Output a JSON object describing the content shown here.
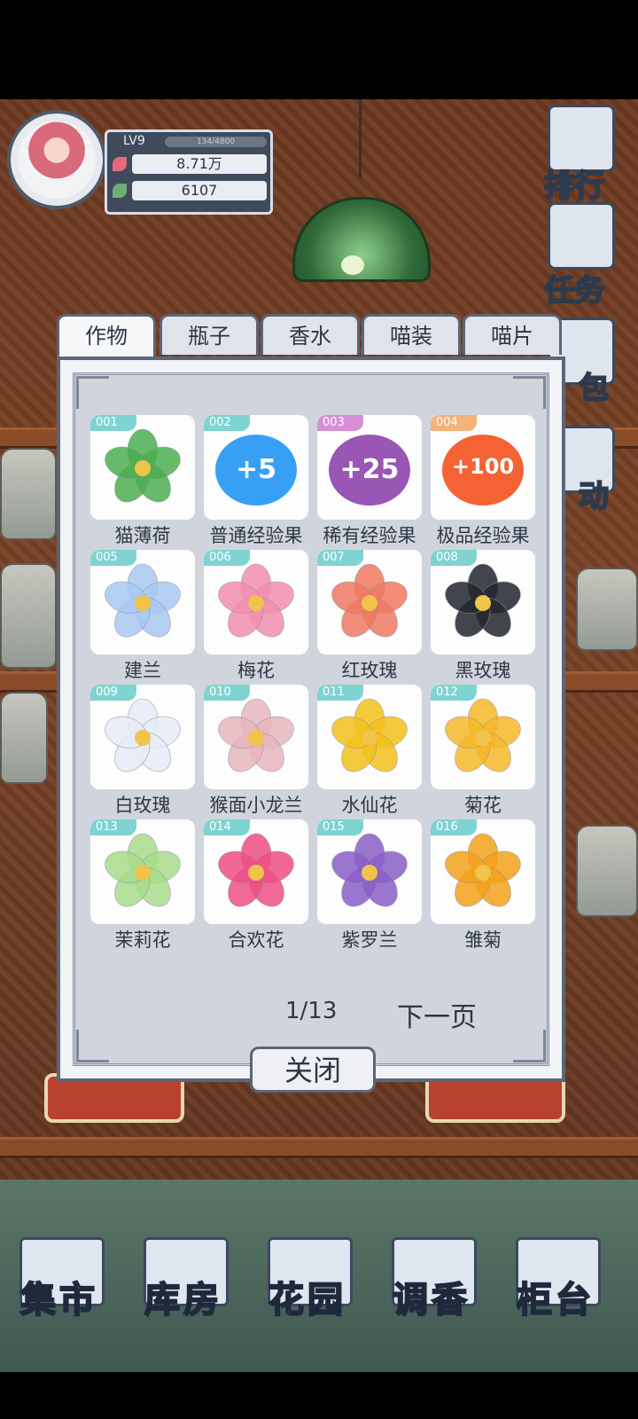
{
  "player": {
    "level": "LV9",
    "exp": "134/4800",
    "coins": "8.71万",
    "gems": "6107"
  },
  "side_menu": [
    {
      "label": "排行",
      "icon": "ranking-icon"
    },
    {
      "label": "任务",
      "icon": "task-clipboard-icon"
    },
    {
      "label": "包",
      "icon": "bag-icon"
    },
    {
      "label": "动",
      "icon": "activity-icon"
    }
  ],
  "tabs": [
    {
      "label": "作物",
      "active": true
    },
    {
      "label": "瓶子",
      "active": false
    },
    {
      "label": "香水",
      "active": false
    },
    {
      "label": "喵装",
      "active": false
    },
    {
      "label": "喵片",
      "active": false
    }
  ],
  "items": [
    {
      "id": "001",
      "name": "猫薄荷",
      "icon": "catnip-icon",
      "color": "#4caf50",
      "badge": "#7fd3d0"
    },
    {
      "id": "002",
      "name": "普通经验果",
      "icon": "exp-fruit-common-icon",
      "color": "#2196f3",
      "badge": "#7fd3d0",
      "value": "+5"
    },
    {
      "id": "003",
      "name": "稀有经验果",
      "icon": "exp-fruit-rare-icon",
      "color": "#8e44ad",
      "badge": "#d58fd6",
      "value": "+25"
    },
    {
      "id": "004",
      "name": "极品经验果",
      "icon": "exp-fruit-epic-icon",
      "color": "#f4511e",
      "badge": "#f2b27a",
      "value": "+100"
    },
    {
      "id": "005",
      "name": "建兰",
      "icon": "orchid-icon",
      "color": "#a9c9f2",
      "badge": "#7fd3d0"
    },
    {
      "id": "006",
      "name": "梅花",
      "icon": "plum-blossom-icon",
      "color": "#f28fb1",
      "badge": "#7fd3d0"
    },
    {
      "id": "007",
      "name": "红玫瑰",
      "icon": "red-rose-icon",
      "color": "#ef7a62",
      "badge": "#7fd3d0"
    },
    {
      "id": "008",
      "name": "黑玫瑰",
      "icon": "black-rose-icon",
      "color": "#23262d",
      "badge": "#7fd3d0"
    },
    {
      "id": "009",
      "name": "白玫瑰",
      "icon": "white-rose-icon",
      "color": "#e8ecf7",
      "badge": "#7fd3d0"
    },
    {
      "id": "010",
      "name": "猴面小龙兰",
      "icon": "monkey-orchid-icon",
      "color": "#e7b7be",
      "badge": "#7fd3d0"
    },
    {
      "id": "011",
      "name": "水仙花",
      "icon": "daffodil-icon",
      "color": "#f3c21b",
      "badge": "#7fd3d0"
    },
    {
      "id": "012",
      "name": "菊花",
      "icon": "chrysanthemum-icon",
      "color": "#f6b829",
      "badge": "#7fd3d0"
    },
    {
      "id": "013",
      "name": "茉莉花",
      "icon": "jasmine-icon",
      "color": "#a8dc8b",
      "badge": "#7fd3d0"
    },
    {
      "id": "014",
      "name": "合欢花",
      "icon": "silk-tree-flower-icon",
      "color": "#ef4f86",
      "badge": "#7fd3d0"
    },
    {
      "id": "015",
      "name": "紫罗兰",
      "icon": "violet-icon",
      "color": "#8a5fc9",
      "badge": "#7fd3d0"
    },
    {
      "id": "016",
      "name": "雏菊",
      "icon": "daisy-icon",
      "color": "#f4a21a",
      "badge": "#7fd3d0"
    }
  ],
  "pager": {
    "text": "1/13",
    "next_label": "下一页"
  },
  "close_label": "关闭",
  "bottom_nav": [
    {
      "label": "集市",
      "icon": "market-gate-icon"
    },
    {
      "label": "库房",
      "icon": "warehouse-icon"
    },
    {
      "label": "花园",
      "icon": "garden-rose-icon"
    },
    {
      "label": "调香",
      "icon": "perfume-mixing-icon"
    },
    {
      "label": "柜台",
      "icon": "counter-shelf-icon"
    }
  ]
}
